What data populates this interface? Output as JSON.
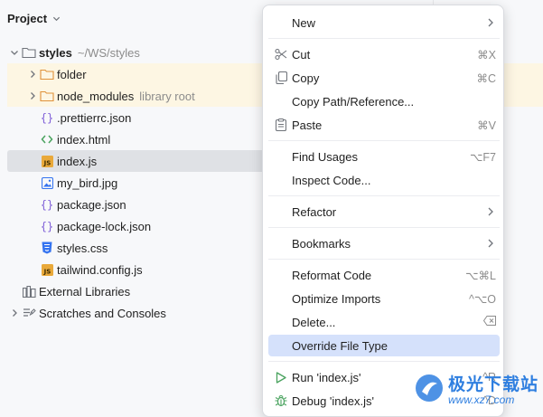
{
  "panel": {
    "title": "Project"
  },
  "tree": {
    "root": {
      "label": "styles",
      "path": "~/WS/styles"
    },
    "items": [
      {
        "label": "folder"
      },
      {
        "label": "node_modules",
        "hint": "library root"
      },
      {
        "label": ".prettierrc.json"
      },
      {
        "label": "index.html"
      },
      {
        "label": "index.js"
      },
      {
        "label": "my_bird.jpg"
      },
      {
        "label": "package.json"
      },
      {
        "label": "package-lock.json"
      },
      {
        "label": "styles.css"
      },
      {
        "label": "tailwind.config.js"
      }
    ],
    "external": {
      "label": "External Libraries"
    },
    "scratches": {
      "label": "Scratches and Consoles"
    }
  },
  "menu": {
    "new": {
      "label": "New"
    },
    "cut": {
      "label": "Cut",
      "shortcut": "⌘X"
    },
    "copy": {
      "label": "Copy",
      "shortcut": "⌘C"
    },
    "copy_path": {
      "label": "Copy Path/Reference..."
    },
    "paste": {
      "label": "Paste",
      "shortcut": "⌘V"
    },
    "find_usages": {
      "label": "Find Usages",
      "shortcut": "⌥F7"
    },
    "inspect_code": {
      "label": "Inspect Code..."
    },
    "refactor": {
      "label": "Refactor"
    },
    "bookmarks": {
      "label": "Bookmarks"
    },
    "reformat_code": {
      "label": "Reformat Code",
      "shortcut": "⌥⌘L"
    },
    "optimize_imports": {
      "label": "Optimize Imports",
      "shortcut": "^⌥O"
    },
    "delete": {
      "label": "Delete..."
    },
    "override_file_type": {
      "label": "Override File Type"
    },
    "run": {
      "label": "Run 'index.js'",
      "shortcut": "^R"
    },
    "debug": {
      "label": "Debug 'index.js'",
      "shortcut": "^D"
    }
  },
  "watermark": {
    "title": "极光下载站",
    "url": "www.xz7.com"
  },
  "colors": {
    "accent": "#3574f0",
    "selection": "#d5e1fb",
    "highlight": "#fdf6e3"
  }
}
